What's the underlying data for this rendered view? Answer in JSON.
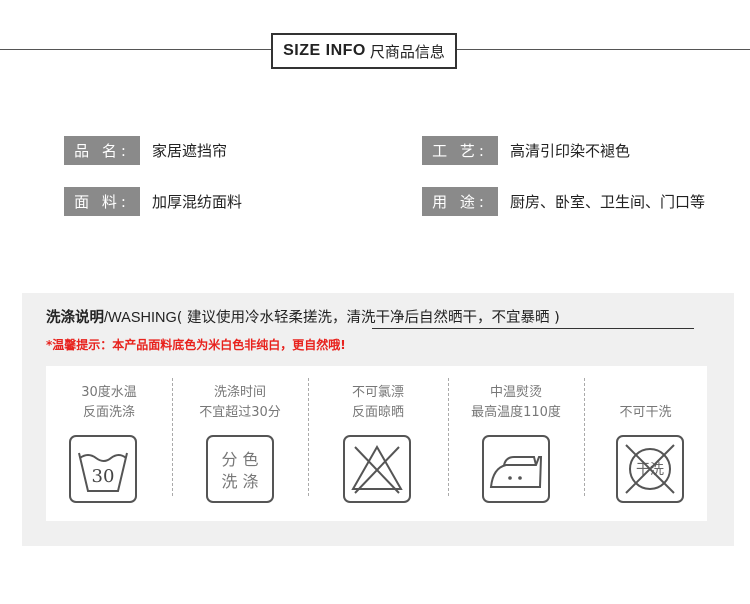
{
  "header": {
    "title_en": "SIZE INFO",
    "title_zh": "尺商品信息"
  },
  "product_info": [
    {
      "label": "品 名:",
      "value": "家居遮挡帘"
    },
    {
      "label": "工 艺:",
      "value": "高清引印染不褪色"
    },
    {
      "label": "面 料:",
      "value": "加厚混纺面料"
    },
    {
      "label": "用 途:",
      "value": "厨房、卧室、卫生间、门口等"
    }
  ],
  "care": {
    "title_bold": "洗涤说明",
    "title_en": "/WASHING",
    "title_note": "( 建议使用冷水轻柔搓洗，清洗干净后自然晒干，不宜暴晒 )",
    "warning": "*温馨提示：本产品面料底色为米白色非纯白，更自然哦!",
    "items": [
      {
        "line1": "30度水温",
        "line2": "反面洗涤",
        "icon": "wash-30-icon",
        "icon_text": "30"
      },
      {
        "line1": "洗涤时间",
        "line2": "不宜超过30分",
        "icon": "separate-wash-icon",
        "icon_text_1": "分 色",
        "icon_text_2": "洗 涤"
      },
      {
        "line1": "不可氯漂",
        "line2": "反面晾晒",
        "icon": "no-bleach-icon"
      },
      {
        "line1": "中温熨烫",
        "line2": "最高温度110度",
        "icon": "iron-medium-icon"
      },
      {
        "line1": "不可干洗",
        "line2": "",
        "icon": "no-dry-clean-icon",
        "icon_text": "干洗"
      }
    ]
  }
}
